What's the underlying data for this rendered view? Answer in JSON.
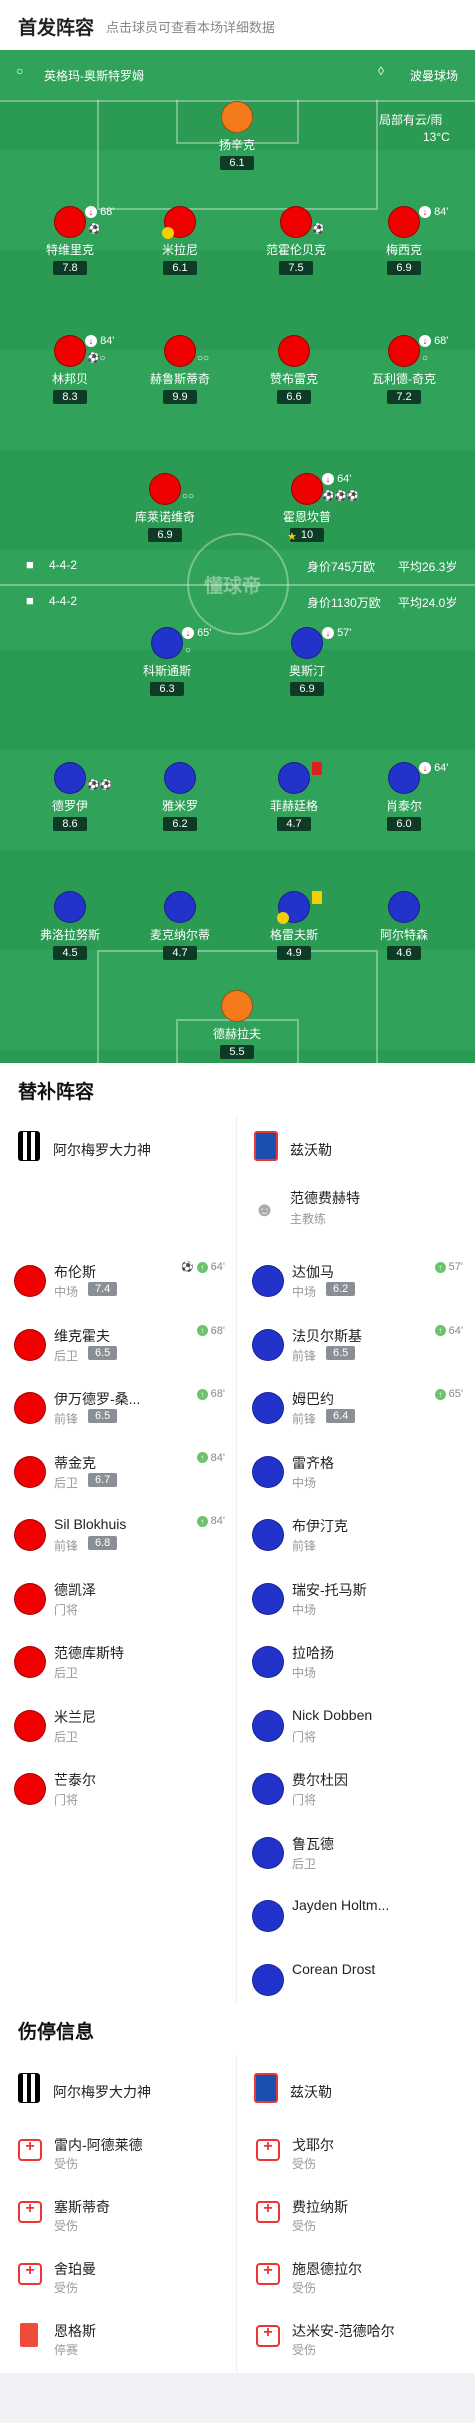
{
  "header": {
    "title": "首发阵容",
    "hint": "点击球员可查看本场详细数据"
  },
  "match": {
    "home_team": "英格玛-奥斯特罗姆",
    "venue": "波曼球场",
    "weather": "局部有云/雨",
    "temp": "13°C",
    "watermark": "懂球帝"
  },
  "home_form": {
    "formation": "4-4-2",
    "value": "身价745万欧",
    "age": "平均26.3岁"
  },
  "away_form": {
    "formation": "4-4-2",
    "value": "身价1130万欧",
    "age": "平均24.0岁"
  },
  "home_players": [
    {
      "name": "扬辛克",
      "rating": "6.1",
      "color": "orange"
    },
    {
      "name": "特维里克",
      "rating": "7.8",
      "minute": "68'"
    },
    {
      "name": "米拉尼",
      "rating": "6.1"
    },
    {
      "name": "范霍伦贝克",
      "rating": "7.5"
    },
    {
      "name": "梅西克",
      "rating": "6.9",
      "minute": "84'"
    },
    {
      "name": "林邦贝",
      "rating": "8.3",
      "minute": "84'"
    },
    {
      "name": "赫鲁斯蒂奇",
      "rating": "9.9"
    },
    {
      "name": "赞布雷克",
      "rating": "6.6"
    },
    {
      "name": "瓦利德-奇克",
      "rating": "7.2",
      "minute": "68'"
    },
    {
      "name": "库莱诺维奇",
      "rating": "6.9"
    },
    {
      "name": "霍恩坎普",
      "rating": "10",
      "minute": "64'"
    }
  ],
  "away_players": [
    {
      "name": "科斯通斯",
      "rating": "6.3",
      "minute": "65'"
    },
    {
      "name": "奥斯汀",
      "rating": "6.9",
      "minute": "57'"
    },
    {
      "name": "德罗伊",
      "rating": "8.6"
    },
    {
      "name": "雅米罗",
      "rating": "6.2"
    },
    {
      "name": "菲赫廷格",
      "rating": "4.7"
    },
    {
      "name": "肖泰尔",
      "rating": "6.0",
      "minute": "64'"
    },
    {
      "name": "弗洛拉努斯",
      "rating": "4.5"
    },
    {
      "name": "麦克纳尔蒂",
      "rating": "4.7"
    },
    {
      "name": "格雷夫斯",
      "rating": "4.9"
    },
    {
      "name": "阿尔特森",
      "rating": "4.6"
    },
    {
      "name": "德赫拉夫",
      "rating": "5.5",
      "color": "orange"
    }
  ],
  "subs": {
    "title": "替补阵容",
    "home_team": "阿尔梅罗大力神",
    "away_team": "兹沃勒",
    "coach": {
      "name": "范德费赫特",
      "role": "主教练"
    },
    "home": [
      {
        "name": "布伦斯",
        "pos": "中场",
        "rating": "7.4",
        "minute": "64'"
      },
      {
        "name": "维克霍夫",
        "pos": "后卫",
        "rating": "6.5",
        "minute": "68'"
      },
      {
        "name": "伊万德罗-桑...",
        "pos": "前锋",
        "rating": "6.5",
        "minute": "68'"
      },
      {
        "name": "蒂金克",
        "pos": "后卫",
        "rating": "6.7",
        "minute": "84'"
      },
      {
        "name": "Sil Blokhuis",
        "pos": "前锋",
        "rating": "6.8",
        "minute": "84'"
      },
      {
        "name": "德凯泽",
        "pos": "门将"
      },
      {
        "name": "范德库斯特",
        "pos": "后卫"
      },
      {
        "name": "米兰尼",
        "pos": "后卫"
      },
      {
        "name": "芒泰尔",
        "pos": "门将"
      }
    ],
    "away": [
      {
        "name": "达伽马",
        "pos": "中场",
        "rating": "6.2",
        "minute": "57'"
      },
      {
        "name": "法贝尔斯基",
        "pos": "前锋",
        "rating": "6.5",
        "minute": "64'"
      },
      {
        "name": "姆巴约",
        "pos": "前锋",
        "rating": "6.4",
        "minute": "65'"
      },
      {
        "name": "雷齐格",
        "pos": "中场"
      },
      {
        "name": "布伊汀克",
        "pos": "前锋"
      },
      {
        "name": "瑞安-托马斯",
        "pos": "中场"
      },
      {
        "name": "拉哈扬",
        "pos": "中场"
      },
      {
        "name": "Nick Dobben",
        "pos": "门将"
      },
      {
        "name": "费尔杜因",
        "pos": "门将"
      },
      {
        "name": "鲁瓦德",
        "pos": "后卫"
      },
      {
        "name": "Jayden Holtm...",
        "pos": ""
      },
      {
        "name": "Corean Drost",
        "pos": ""
      }
    ]
  },
  "injuries": {
    "title": "伤停信息",
    "home_team": "阿尔梅罗大力神",
    "away_team": "兹沃勒",
    "home": [
      {
        "name": "雷内-阿德莱德",
        "reason": "受伤"
      },
      {
        "name": "塞斯蒂奇",
        "reason": "受伤"
      },
      {
        "name": "舍珀曼",
        "reason": "受伤"
      },
      {
        "name": "恩格斯",
        "reason": "停赛"
      }
    ],
    "away": [
      {
        "name": "戈耶尔",
        "reason": "受伤"
      },
      {
        "name": "费拉纳斯",
        "reason": "受伤"
      },
      {
        "name": "施恩德拉尔",
        "reason": "受伤"
      },
      {
        "name": "达米安-范德哈尔",
        "reason": "受伤"
      }
    ]
  },
  "colors": {
    "home": "#f00000",
    "away": "#2233cc",
    "gk": "#f57a1c",
    "pitch": "#2b9a52"
  }
}
